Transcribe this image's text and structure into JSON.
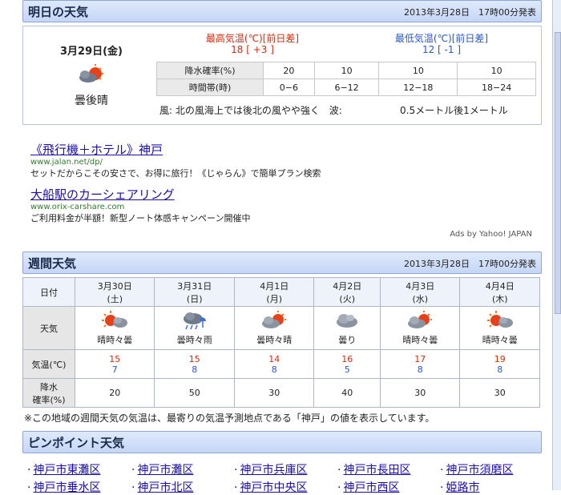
{
  "tomorrow": {
    "header_title": "明日の天気",
    "header_date": "2013年3月28日　17時00分発表",
    "date": "3月29日(金)",
    "weather": "曇後晴",
    "icon": "cloud-then-sun-icon",
    "max_label": "最高気温(℃)[前日差]",
    "max_value": "18 [ +3 ]",
    "min_label": "最低気温(℃)[前日差]",
    "min_value": "12 [ -1 ]",
    "rain_label": "降水確率(%)",
    "rain_values": [
      "20",
      "10",
      "10",
      "10"
    ],
    "time_label": "時間帯(時)",
    "time_values": [
      "0−6",
      "6−12",
      "12−18",
      "18−24"
    ],
    "wind_label": "風:",
    "wind_text": "北の風海上では後北の風やや強く",
    "wave_label": "波:",
    "wave_text": "0.5メートル後1メートル"
  },
  "ads": [
    {
      "title": "《飛行機＋ホテル》神戸",
      "url": "www.jalan.net/dp/",
      "desc": "セットだからこその安さで、お得に旅行！《じゃらん》で簡単プラン検索"
    },
    {
      "title": "大船駅のカーシェアリング",
      "url": "www.orix-carshare.com",
      "desc": "ご利用料金が半額！新型ノート体感キャンペーン開催中"
    }
  ],
  "ads_credit": "Ads by Yahoo! JAPAN",
  "weekly": {
    "header_title": "週間天気",
    "header_date": "2013年3月28日　17時00分発表",
    "label_date": "日付",
    "label_weather": "天気",
    "label_temp": "気温(℃)",
    "label_rain_1": "降水",
    "label_rain_2": "確率(%)",
    "days": [
      {
        "date": "3月30日",
        "dow": "(土)",
        "weather": "晴時々曇",
        "icon": "sun-cloud-icon",
        "high": "15",
        "low": "7",
        "rain": "20"
      },
      {
        "date": "3月31日",
        "dow": "(日)",
        "weather": "曇時々雨",
        "icon": "cloud-rain-icon",
        "high": "15",
        "low": "8",
        "rain": "50"
      },
      {
        "date": "4月1日",
        "dow": "(月)",
        "weather": "曇時々晴",
        "icon": "cloud-sun-icon",
        "high": "14",
        "low": "8",
        "rain": "30"
      },
      {
        "date": "4月2日",
        "dow": "(火)",
        "weather": "曇り",
        "icon": "cloud-icon",
        "high": "16",
        "low": "5",
        "rain": "40"
      },
      {
        "date": "4月3日",
        "dow": "(水)",
        "weather": "晴時々曇",
        "icon": "cloud-sun-icon",
        "high": "17",
        "low": "8",
        "rain": "30"
      },
      {
        "date": "4月4日",
        "dow": "(木)",
        "weather": "晴時々曇",
        "icon": "sun-cloud-icon",
        "high": "19",
        "low": "8",
        "rain": "30"
      }
    ],
    "note": "※この地域の週間天気の気温は、最寄りの気温予測地点である「神戸」の値を表示しています。"
  },
  "pinpoint": {
    "header_title": "ピンポイント天気",
    "row1": [
      "神戸市東灘区",
      "神戸市灘区",
      "神戸市兵庫区",
      "神戸市長田区",
      "神戸市須磨区"
    ],
    "row2": [
      "神戸市垂水区",
      "神戸市北区",
      "神戸市中央区",
      "神戸市西区",
      "姫路市"
    ]
  },
  "colors": {
    "header_bg": "#c4d6f6",
    "high_temp": "#d12b0c",
    "low_temp": "#2a57c9",
    "link": "#1a0dab"
  }
}
